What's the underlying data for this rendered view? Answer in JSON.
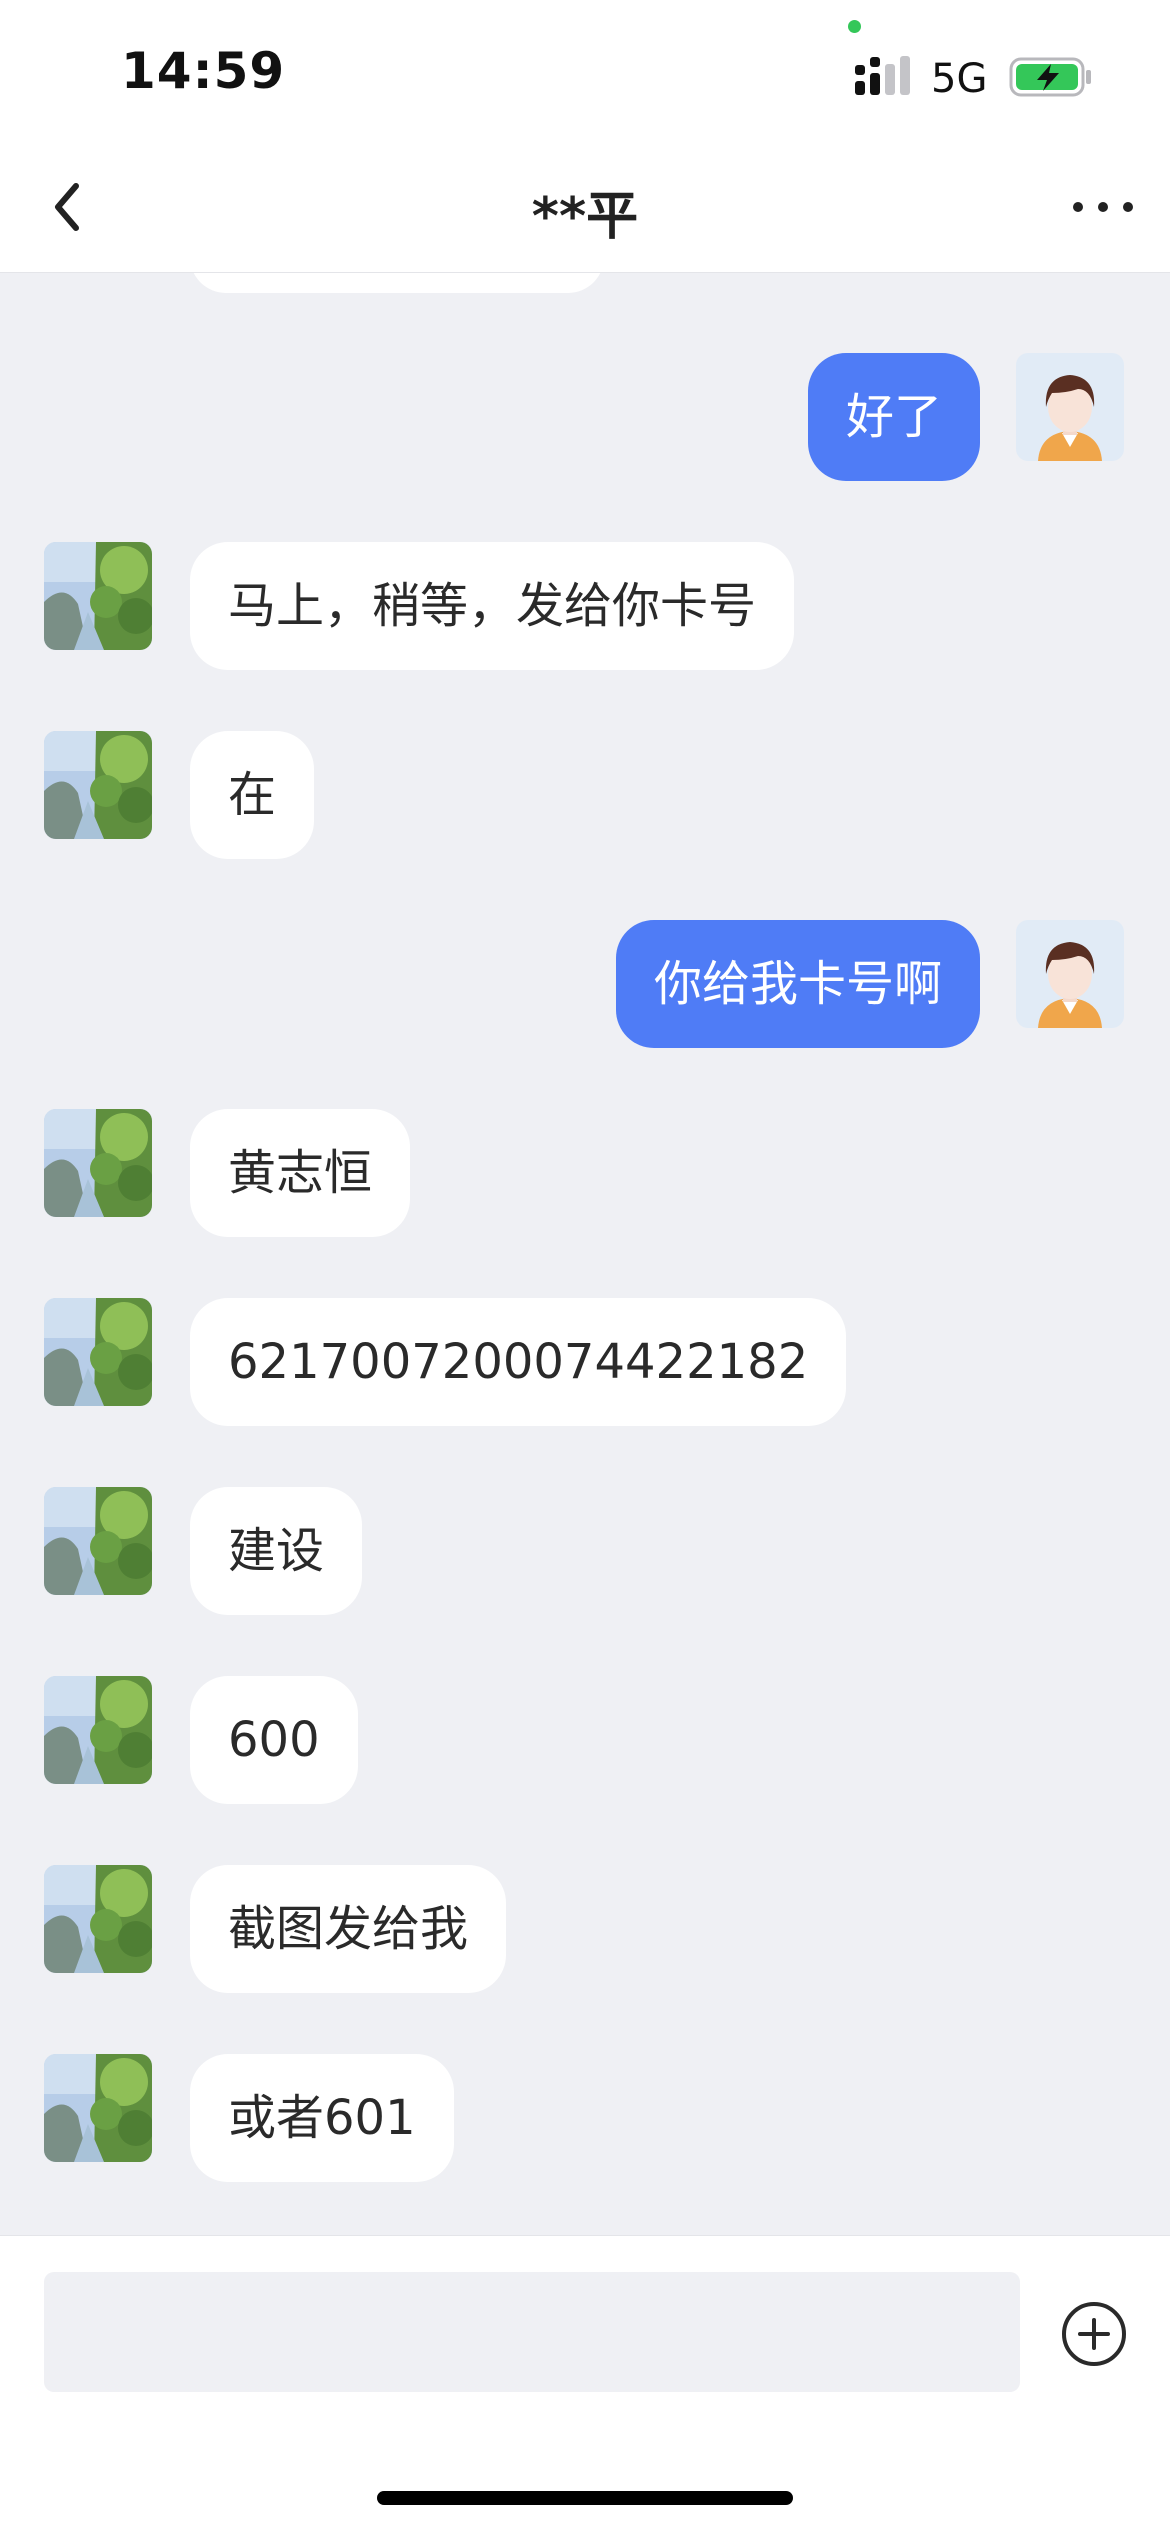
{
  "status_bar": {
    "time": "14:59",
    "network": "5G",
    "signal_icon": "cellular-signal-icon",
    "battery_icon": "battery-charging-icon",
    "camera_indicator_color": "#34c759"
  },
  "header": {
    "title": "**平",
    "back_icon": "chevron-left-icon",
    "more_icon": "more-dots-icon"
  },
  "colors": {
    "outgoing_bubble": "#4f7cf6",
    "incoming_bubble": "#ffffff",
    "chat_background": "#eff0f4",
    "battery_fill": "#34c759"
  },
  "messages": [
    {
      "direction": "outgoing",
      "text": "好了"
    },
    {
      "direction": "incoming",
      "text": "马上，稍等，发给你卡号"
    },
    {
      "direction": "incoming",
      "text": "在"
    },
    {
      "direction": "outgoing",
      "text": "你给我卡号啊"
    },
    {
      "direction": "incoming",
      "text": "黄志恒"
    },
    {
      "direction": "incoming",
      "text": "6217007200074422182"
    },
    {
      "direction": "incoming",
      "text": "建设"
    },
    {
      "direction": "incoming",
      "text": "600"
    },
    {
      "direction": "incoming",
      "text": "截图发给我"
    },
    {
      "direction": "incoming",
      "text": "或者601"
    }
  ],
  "avatars": {
    "incoming": "landscape-photo-avatar",
    "outgoing": "cartoon-person-avatar"
  },
  "input": {
    "value": "",
    "placeholder": "",
    "add_icon": "plus-circle-icon"
  }
}
